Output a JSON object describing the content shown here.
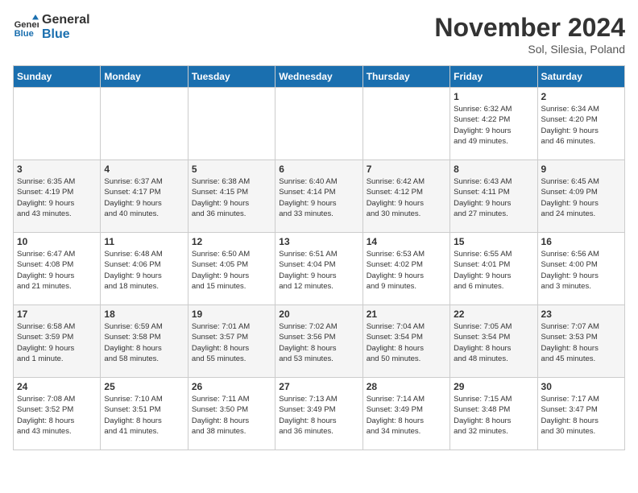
{
  "header": {
    "logo_line1": "General",
    "logo_line2": "Blue",
    "month_year": "November 2024",
    "location": "Sol, Silesia, Poland"
  },
  "weekdays": [
    "Sunday",
    "Monday",
    "Tuesday",
    "Wednesday",
    "Thursday",
    "Friday",
    "Saturday"
  ],
  "weeks": [
    [
      {
        "day": "",
        "info": ""
      },
      {
        "day": "",
        "info": ""
      },
      {
        "day": "",
        "info": ""
      },
      {
        "day": "",
        "info": ""
      },
      {
        "day": "",
        "info": ""
      },
      {
        "day": "1",
        "info": "Sunrise: 6:32 AM\nSunset: 4:22 PM\nDaylight: 9 hours\nand 49 minutes."
      },
      {
        "day": "2",
        "info": "Sunrise: 6:34 AM\nSunset: 4:20 PM\nDaylight: 9 hours\nand 46 minutes."
      }
    ],
    [
      {
        "day": "3",
        "info": "Sunrise: 6:35 AM\nSunset: 4:19 PM\nDaylight: 9 hours\nand 43 minutes."
      },
      {
        "day": "4",
        "info": "Sunrise: 6:37 AM\nSunset: 4:17 PM\nDaylight: 9 hours\nand 40 minutes."
      },
      {
        "day": "5",
        "info": "Sunrise: 6:38 AM\nSunset: 4:15 PM\nDaylight: 9 hours\nand 36 minutes."
      },
      {
        "day": "6",
        "info": "Sunrise: 6:40 AM\nSunset: 4:14 PM\nDaylight: 9 hours\nand 33 minutes."
      },
      {
        "day": "7",
        "info": "Sunrise: 6:42 AM\nSunset: 4:12 PM\nDaylight: 9 hours\nand 30 minutes."
      },
      {
        "day": "8",
        "info": "Sunrise: 6:43 AM\nSunset: 4:11 PM\nDaylight: 9 hours\nand 27 minutes."
      },
      {
        "day": "9",
        "info": "Sunrise: 6:45 AM\nSunset: 4:09 PM\nDaylight: 9 hours\nand 24 minutes."
      }
    ],
    [
      {
        "day": "10",
        "info": "Sunrise: 6:47 AM\nSunset: 4:08 PM\nDaylight: 9 hours\nand 21 minutes."
      },
      {
        "day": "11",
        "info": "Sunrise: 6:48 AM\nSunset: 4:06 PM\nDaylight: 9 hours\nand 18 minutes."
      },
      {
        "day": "12",
        "info": "Sunrise: 6:50 AM\nSunset: 4:05 PM\nDaylight: 9 hours\nand 15 minutes."
      },
      {
        "day": "13",
        "info": "Sunrise: 6:51 AM\nSunset: 4:04 PM\nDaylight: 9 hours\nand 12 minutes."
      },
      {
        "day": "14",
        "info": "Sunrise: 6:53 AM\nSunset: 4:02 PM\nDaylight: 9 hours\nand 9 minutes."
      },
      {
        "day": "15",
        "info": "Sunrise: 6:55 AM\nSunset: 4:01 PM\nDaylight: 9 hours\nand 6 minutes."
      },
      {
        "day": "16",
        "info": "Sunrise: 6:56 AM\nSunset: 4:00 PM\nDaylight: 9 hours\nand 3 minutes."
      }
    ],
    [
      {
        "day": "17",
        "info": "Sunrise: 6:58 AM\nSunset: 3:59 PM\nDaylight: 9 hours\nand 1 minute."
      },
      {
        "day": "18",
        "info": "Sunrise: 6:59 AM\nSunset: 3:58 PM\nDaylight: 8 hours\nand 58 minutes."
      },
      {
        "day": "19",
        "info": "Sunrise: 7:01 AM\nSunset: 3:57 PM\nDaylight: 8 hours\nand 55 minutes."
      },
      {
        "day": "20",
        "info": "Sunrise: 7:02 AM\nSunset: 3:56 PM\nDaylight: 8 hours\nand 53 minutes."
      },
      {
        "day": "21",
        "info": "Sunrise: 7:04 AM\nSunset: 3:54 PM\nDaylight: 8 hours\nand 50 minutes."
      },
      {
        "day": "22",
        "info": "Sunrise: 7:05 AM\nSunset: 3:54 PM\nDaylight: 8 hours\nand 48 minutes."
      },
      {
        "day": "23",
        "info": "Sunrise: 7:07 AM\nSunset: 3:53 PM\nDaylight: 8 hours\nand 45 minutes."
      }
    ],
    [
      {
        "day": "24",
        "info": "Sunrise: 7:08 AM\nSunset: 3:52 PM\nDaylight: 8 hours\nand 43 minutes."
      },
      {
        "day": "25",
        "info": "Sunrise: 7:10 AM\nSunset: 3:51 PM\nDaylight: 8 hours\nand 41 minutes."
      },
      {
        "day": "26",
        "info": "Sunrise: 7:11 AM\nSunset: 3:50 PM\nDaylight: 8 hours\nand 38 minutes."
      },
      {
        "day": "27",
        "info": "Sunrise: 7:13 AM\nSunset: 3:49 PM\nDaylight: 8 hours\nand 36 minutes."
      },
      {
        "day": "28",
        "info": "Sunrise: 7:14 AM\nSunset: 3:49 PM\nDaylight: 8 hours\nand 34 minutes."
      },
      {
        "day": "29",
        "info": "Sunrise: 7:15 AM\nSunset: 3:48 PM\nDaylight: 8 hours\nand 32 minutes."
      },
      {
        "day": "30",
        "info": "Sunrise: 7:17 AM\nSunset: 3:47 PM\nDaylight: 8 hours\nand 30 minutes."
      }
    ]
  ]
}
